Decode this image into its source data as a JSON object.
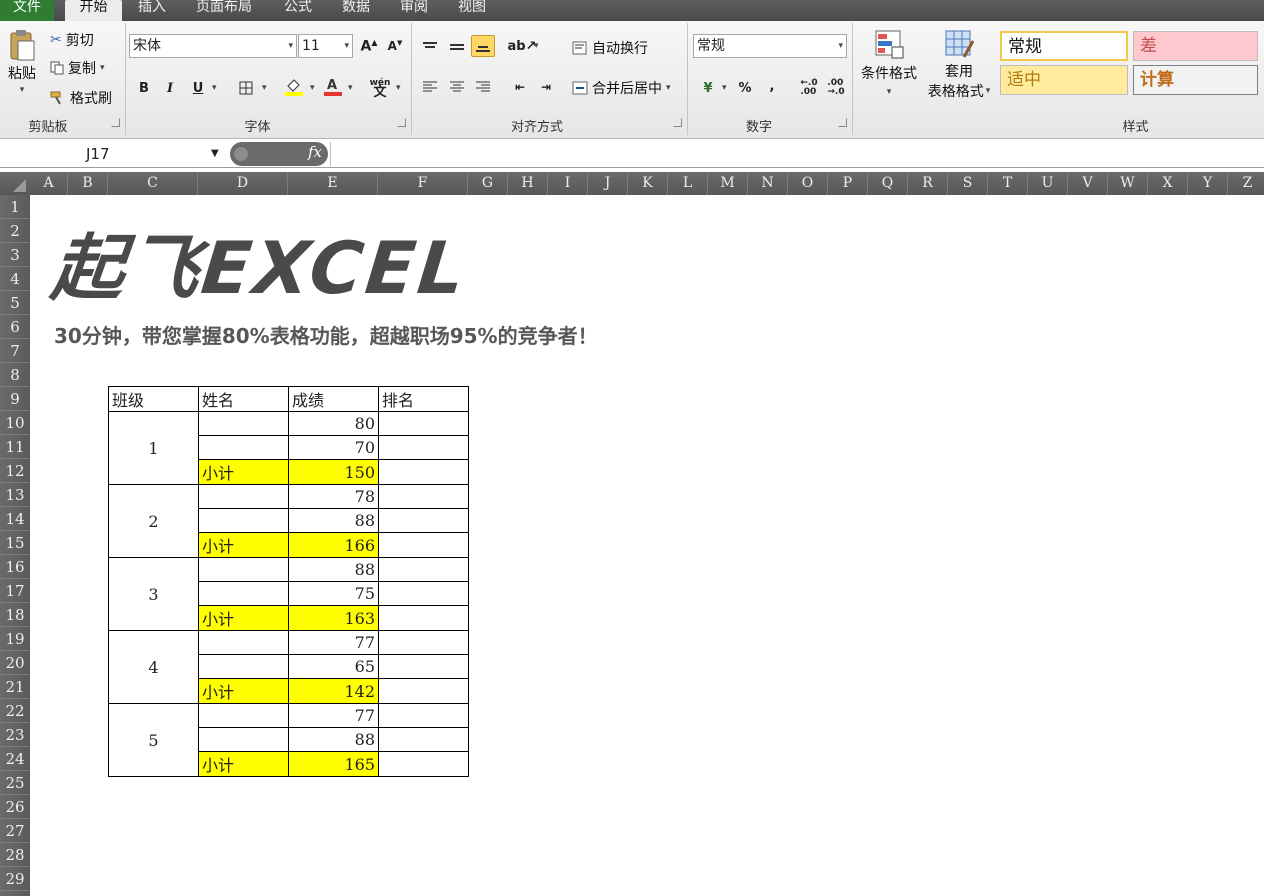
{
  "tabs": {
    "file": "文件",
    "home": "开始",
    "insert": "插入",
    "page_layout": "页面布局",
    "formulas": "公式",
    "data": "数据",
    "review": "审阅",
    "view": "视图"
  },
  "clipboard": {
    "paste": "粘贴",
    "cut": "剪切",
    "copy": "复制",
    "format_painter": "格式刷",
    "group_label": "剪贴板"
  },
  "font": {
    "name": "宋体",
    "size": "11",
    "bold": "B",
    "italic": "I",
    "underline": "U",
    "wen": "wén",
    "group_label": "字体"
  },
  "alignment": {
    "wrap_text": "自动换行",
    "merge_center": "合并后居中",
    "group_label": "对齐方式"
  },
  "number": {
    "format": "常规",
    "percent": "%",
    "comma": ",",
    "group_label": "数字"
  },
  "styles": {
    "conditional_format": "条件格式",
    "table_format_line1": "套用",
    "table_format_line2": "表格格式",
    "normal": "常规",
    "bad": "差",
    "neutral": "适中",
    "calculation": "计算",
    "group_label": "样式"
  },
  "formula_bar": {
    "name_box": "J17",
    "fx": "fx",
    "formula": ""
  },
  "columns": [
    "A",
    "B",
    "C",
    "D",
    "E",
    "F",
    "G",
    "H",
    "I",
    "J",
    "K",
    "L",
    "M",
    "N",
    "O",
    "P",
    "Q",
    "R",
    "S",
    "T",
    "U",
    "V",
    "W",
    "X",
    "Y",
    "Z"
  ],
  "rows": [
    "1",
    "2",
    "3",
    "4",
    "5",
    "6",
    "7",
    "8",
    "9",
    "10",
    "11",
    "12",
    "13",
    "14",
    "15",
    "16",
    "17",
    "18",
    "19",
    "20",
    "21",
    "22",
    "23",
    "24",
    "25",
    "26",
    "27",
    "28",
    "29"
  ],
  "sheet": {
    "logo": "起飞EXCEL",
    "subtitle": "30分钟，带您掌握80%表格功能，超越职场95%的竞争者！",
    "headers": [
      "班级",
      "姓名",
      "成绩",
      "排名"
    ],
    "subtotal_label": "小计",
    "groups": [
      {
        "class": "1",
        "scores": [
          "80",
          "70"
        ],
        "subtotal": "150"
      },
      {
        "class": "2",
        "scores": [
          "78",
          "88"
        ],
        "subtotal": "166"
      },
      {
        "class": "3",
        "scores": [
          "88",
          "75"
        ],
        "subtotal": "163"
      },
      {
        "class": "4",
        "scores": [
          "77",
          "65"
        ],
        "subtotal": "142"
      },
      {
        "class": "5",
        "scores": [
          "77",
          "88"
        ],
        "subtotal": "165"
      }
    ]
  },
  "colors": {
    "subtotal_fill": "#ffff00",
    "file_tab": "#2e7d32",
    "bad_fill": "#ffc7ce",
    "neutral_fill": "#ffeb9c"
  }
}
